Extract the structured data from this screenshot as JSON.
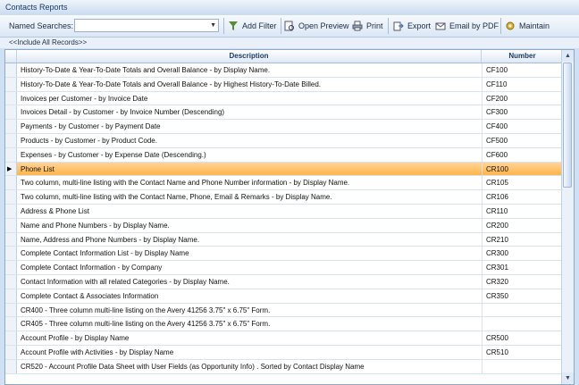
{
  "window": {
    "title": "Contacts Reports"
  },
  "toolbar": {
    "named_searches_label": "Named Searches:",
    "named_searches_value": "",
    "add_filter": "Add Filter",
    "open_preview": "Open Preview",
    "print": "Print",
    "export": "Export",
    "email_by_pdf": "Email by PDF",
    "maintain": "Maintain"
  },
  "filter_text": "<<Include All Records>>",
  "grid": {
    "columns": {
      "description": "Description",
      "number": "Number"
    },
    "selected_row": 7,
    "rows": [
      {
        "description": "History-To-Date & Year-To-Date Totals and Overall Balance - by Display Name.",
        "number": "CF100"
      },
      {
        "description": "History-To-Date & Year-To-Date Totals and Overall Balance - by Highest History-To-Date Billed.",
        "number": "CF110"
      },
      {
        "description": "Invoices per Customer - by Invoice Date",
        "number": "CF200"
      },
      {
        "description": "Invoices Detail  - by Customer - by Invoice Number (Descending)",
        "number": "CF300"
      },
      {
        "description": "Payments - by Customer - by Payment Date",
        "number": "CF400"
      },
      {
        "description": "Products - by Customer - by Product Code.",
        "number": "CF500"
      },
      {
        "description": "Expenses - by Customer - by Expense Date (Descending.)",
        "number": "CF600"
      },
      {
        "description": "Phone List",
        "number": "CR100"
      },
      {
        "description": "Two column, multi-line listing with the Contact Name and Phone Number information - by Display Name.",
        "number": "CR105"
      },
      {
        "description": "Two column, multi-line listing with the Contact Name, Phone, Email & Remarks - by Display Name.",
        "number": "CR106"
      },
      {
        "description": "Address & Phone List",
        "number": "CR110"
      },
      {
        "description": "Name and Phone Numbers - by Display Name.",
        "number": "CR200"
      },
      {
        "description": "Name, Address and Phone Numbers - by Display Name.",
        "number": "CR210"
      },
      {
        "description": "Complete Contact Information List - by Display Name",
        "number": "CR300"
      },
      {
        "description": "Complete Contact Information - by Company",
        "number": "CR301"
      },
      {
        "description": "Contact Information with all related Categories - by Display Name.",
        "number": "CR320"
      },
      {
        "description": "Complete Contact & Associates Information",
        "number": "CR350"
      },
      {
        "description": "CR400 - Three column multi-line listing on the Avery 41256 3.75\" x 6.75\" Form.",
        "number": ""
      },
      {
        "description": "CR405 - Three column multi-line listing on the Avery 41256 3.75\" x 6.75\" Form.",
        "number": ""
      },
      {
        "description": "Account Profile - by Display Name",
        "number": "CR500"
      },
      {
        "description": "Account Profile  with Activities - by Display Name",
        "number": "CR510"
      },
      {
        "description": "CR520 - Account Profile Data Sheet with User Fields (as Opportunity Info) .  Sorted by Contact Display Name",
        "number": ""
      }
    ]
  }
}
